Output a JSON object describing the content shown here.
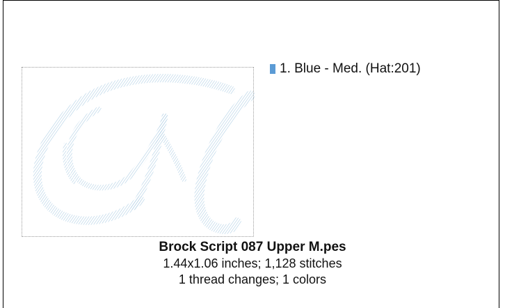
{
  "legend": {
    "items": [
      {
        "label": "1.  Blue - Med. (Hat:201)",
        "color": "#5b9bd5"
      }
    ]
  },
  "preview": {
    "icon": "embroidery-letter-m-preview",
    "stitch_color": "#a9cbe2"
  },
  "caption": {
    "filename": "Brock Script 087 Upper M.pes",
    "dimensions": "1.44x1.06 inches; 1,128 stitches",
    "changes": "1 thread changes; 1 colors"
  }
}
